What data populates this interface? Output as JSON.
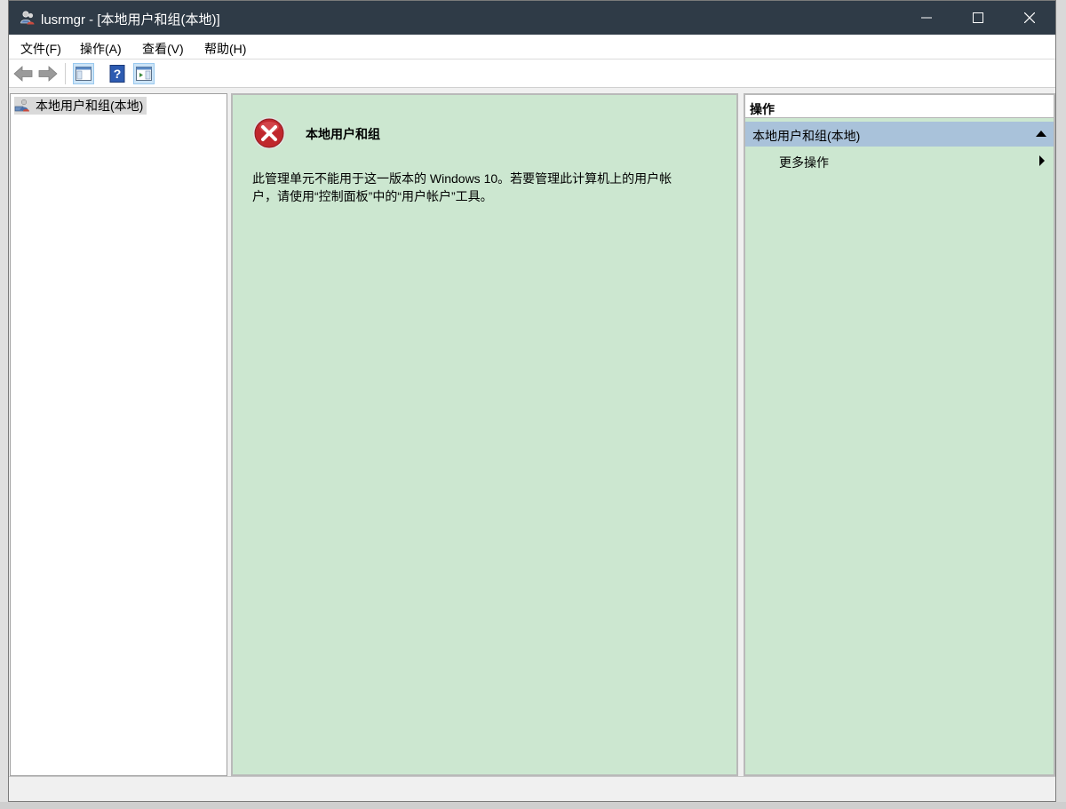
{
  "window": {
    "title": "lusrmgr - [本地用户和组(本地)]",
    "controls": {
      "minimize": "—",
      "maximize": "☐",
      "close": "✕"
    }
  },
  "menu": [
    {
      "label": "文件(F)"
    },
    {
      "label": "操作(A)"
    },
    {
      "label": "查看(V)"
    },
    {
      "label": "帮助(H)"
    }
  ],
  "toolbar": {
    "buttons": [
      "back-arrow-icon",
      "forward-arrow-icon",
      "show-hide-console-tree-icon",
      "help-icon",
      "show-hide-action-pane-icon"
    ]
  },
  "tree": {
    "root_label": "本地用户和组(本地)"
  },
  "center": {
    "title": "本地用户和组",
    "message": "此管理单元不能用于这一版本的 Windows 10。若要管理此计算机上的用户帐户，请使用“控制面板”中的“用户帐户”工具。"
  },
  "actions": {
    "header": "操作",
    "group_label": "本地用户和组(本地)",
    "more_actions": "更多操作"
  },
  "colors": {
    "titlebar": "#2f3b47",
    "pane_green": "#cce7d0",
    "group_header": "#a9c2da",
    "error_red": "#c0272d"
  }
}
